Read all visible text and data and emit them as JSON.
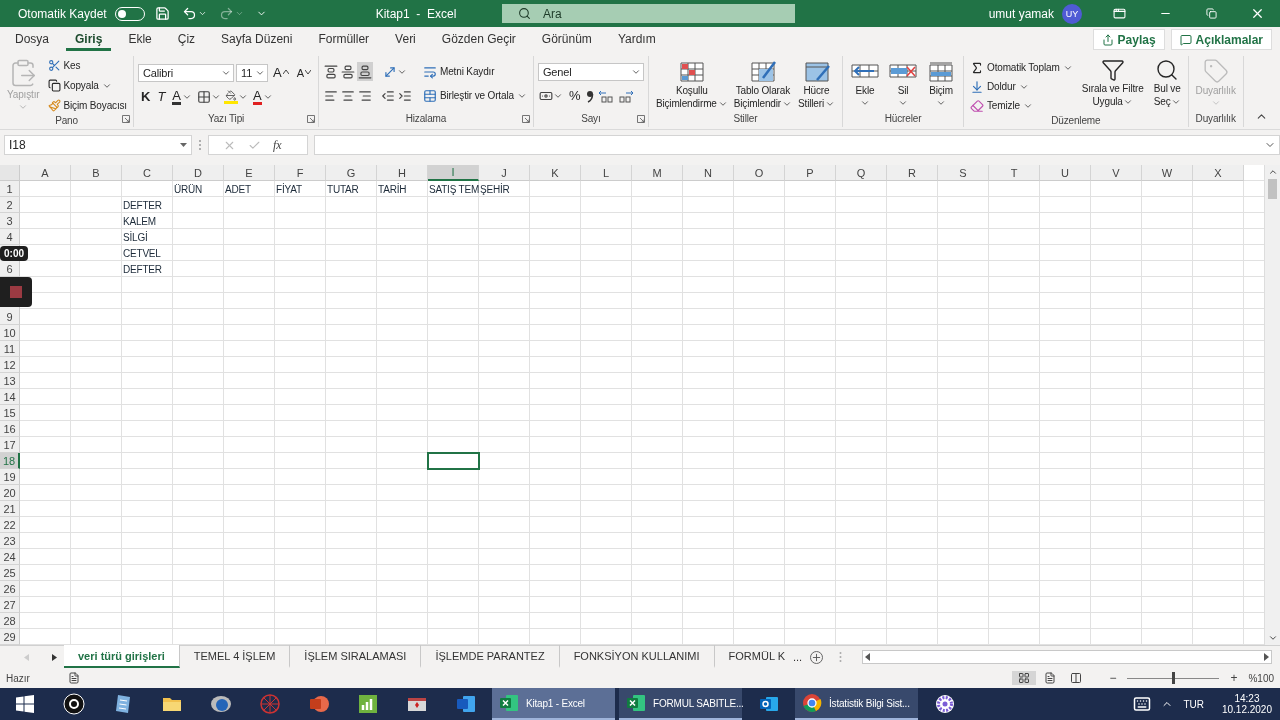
{
  "title_bar": {
    "autosave_label": "Otomatik Kaydet",
    "autosave_on": false,
    "title": "Kitap1  -  Excel",
    "search_placeholder": "Ara",
    "user_name": "umut yamak",
    "user_initials": "UY"
  },
  "menu_tabs": [
    {
      "label": "Dosya",
      "selected": false
    },
    {
      "label": "Giriş",
      "selected": true
    },
    {
      "label": "Ekle",
      "selected": false
    },
    {
      "label": "Çiz",
      "selected": false
    },
    {
      "label": "Sayfa Düzeni",
      "selected": false
    },
    {
      "label": "Formüller",
      "selected": false
    },
    {
      "label": "Veri",
      "selected": false
    },
    {
      "label": "Gözden Geçir",
      "selected": false
    },
    {
      "label": "Görünüm",
      "selected": false
    },
    {
      "label": "Yardım",
      "selected": false
    }
  ],
  "share_button": "Paylaş",
  "comments_button": "Açıklamalar",
  "ribbon": {
    "clipboard": {
      "label": "Pano",
      "paste": "Yapıştır",
      "paste_disabled": true,
      "cut": "Kes",
      "copy": "Kopyala",
      "format_painter": "Biçim Boyacısı"
    },
    "font": {
      "label": "Yazı Tipi",
      "font_name": "Calibri",
      "font_size": "11",
      "grow_font": "A",
      "shrink_font": "A",
      "bold": "K",
      "italic": "T",
      "underline": "A",
      "font_color": "A"
    },
    "alignment": {
      "label": "Hizalama",
      "wrap_text": "Metni Kaydır",
      "merge_center": "Birleştir ve Ortala"
    },
    "number": {
      "label": "Sayı",
      "format": "Genel",
      "percent": "%"
    },
    "styles": {
      "label": "Stiller",
      "buttons": [
        {
          "kind": "conditional",
          "lines": [
            "Koşullu",
            "Biçimlendirme"
          ]
        },
        {
          "kind": "table",
          "lines": [
            "Tablo Olarak",
            "Biçimlendir"
          ]
        },
        {
          "kind": "cellstyle",
          "lines": [
            "Hücre",
            "Stilleri"
          ]
        }
      ]
    },
    "cells": {
      "label": "Hücreler",
      "buttons": [
        {
          "kind": "insert",
          "label": "Ekle"
        },
        {
          "kind": "delete",
          "label": "Sil"
        },
        {
          "kind": "format",
          "label": "Biçim"
        }
      ]
    },
    "editing": {
      "label": "Düzenleme",
      "autosum": "Otomatik Toplam",
      "fill": "Doldur",
      "clear": "Temizle",
      "sort_filter": [
        "Sırala ve Filtre",
        "Uygula"
      ],
      "find_select": [
        "Bul ve",
        "Seç"
      ]
    },
    "sensitivity": {
      "label": "Duyarlılık",
      "button": "Duyarlılık",
      "disabled": true
    }
  },
  "formula_bar": {
    "name_box": "I18",
    "function_label": "fx"
  },
  "columns": [
    {
      "label": "A",
      "selected": false
    },
    {
      "label": "B",
      "selected": false
    },
    {
      "label": "C",
      "selected": false
    },
    {
      "label": "D",
      "selected": false
    },
    {
      "label": "E",
      "selected": false
    },
    {
      "label": "F",
      "selected": false
    },
    {
      "label": "G",
      "selected": false
    },
    {
      "label": "H",
      "selected": false
    },
    {
      "label": "I",
      "selected": true
    },
    {
      "label": "J",
      "selected": false
    },
    {
      "label": "K",
      "selected": false
    },
    {
      "label": "L",
      "selected": false
    },
    {
      "label": "M",
      "selected": false
    },
    {
      "label": "N",
      "selected": false
    },
    {
      "label": "O",
      "selected": false
    },
    {
      "label": "P",
      "selected": false
    },
    {
      "label": "Q",
      "selected": false
    },
    {
      "label": "R",
      "selected": false
    },
    {
      "label": "S",
      "selected": false
    },
    {
      "label": "T",
      "selected": false
    },
    {
      "label": "U",
      "selected": false
    },
    {
      "label": "V",
      "selected": false
    },
    {
      "label": "W",
      "selected": false
    },
    {
      "label": "X",
      "selected": false
    }
  ],
  "rows": [
    {
      "label": "1",
      "selected": false,
      "cells": [
        null,
        null,
        null,
        "ÜRÜN",
        "ADET",
        "FİYAT",
        "TUTAR",
        "TARİH",
        "SATIŞ TEM",
        "ŞEHİR"
      ]
    },
    {
      "label": "2",
      "selected": false,
      "cells": [
        null,
        null,
        "DEFTER"
      ]
    },
    {
      "label": "3",
      "selected": false,
      "cells": [
        null,
        null,
        "KALEM"
      ]
    },
    {
      "label": "4",
      "selected": false,
      "cells": [
        null,
        null,
        "SİLGİ"
      ]
    },
    {
      "cells": [
        null,
        null,
        "CETVEL"
      ]
    },
    {
      "label": "6",
      "selected": false,
      "cells": [
        null,
        null,
        "DEFTER"
      ]
    },
    {},
    {},
    {
      "label": "9",
      "selected": false
    },
    {
      "label": "10",
      "selected": false
    },
    {
      "label": "11",
      "selected": false
    },
    {
      "label": "12",
      "selected": false
    },
    {
      "label": "13",
      "selected": false
    },
    {
      "label": "14",
      "selected": false
    },
    {
      "label": "15",
      "selected": false
    },
    {
      "label": "16",
      "selected": false
    },
    {
      "label": "17",
      "selected": false
    },
    {
      "label": "18",
      "selected": true
    },
    {
      "label": "19",
      "selected": false
    },
    {
      "label": "20",
      "selected": false
    },
    {
      "label": "21",
      "selected": false
    },
    {
      "label": "22",
      "selected": false
    },
    {
      "label": "23",
      "selected": false
    },
    {
      "label": "24",
      "selected": false
    },
    {
      "label": "25",
      "selected": false
    },
    {
      "label": "26",
      "selected": false
    },
    {
      "label": "27",
      "selected": false
    },
    {
      "label": "28",
      "selected": false
    },
    {
      "label": "29",
      "selected": false
    }
  ],
  "recorder": {
    "time": "0:00"
  },
  "sheet_tabs": [
    {
      "label": "veri türü girişleri",
      "selected": true
    },
    {
      "label": "TEMEL 4 İŞLEM",
      "selected": false
    },
    {
      "label": "İŞLEM SIRALAMASI",
      "selected": false
    },
    {
      "label": "İŞLEMDE PARANTEZ",
      "selected": false
    },
    {
      "label": "FONKSİYON KULLANIMI",
      "selected": false
    },
    {
      "label": "FORMÜL K",
      "selected": false
    }
  ],
  "more_sheets": "...",
  "status_bar": {
    "status": "Hazır",
    "zoom_out": "−",
    "zoom_in": "+",
    "zoom": "%100",
    "zoom_level": {
      "level": 0.5
    }
  },
  "taskbar": {
    "items": [
      {
        "kind": "r3"
      },
      {
        "kind": "notepad"
      },
      {
        "kind": "explorer"
      },
      {
        "kind": "r"
      },
      {
        "kind": "web"
      },
      {
        "kind": "powerpoint"
      },
      {
        "kind": "chart"
      },
      {
        "kind": "redbox"
      },
      {
        "kind": "word"
      },
      {
        "kind": "excelwindow",
        "label": "Kitap1 - Excel",
        "selected": true
      },
      {
        "kind": "excelwindow",
        "label": "FORMUL SABITLE...",
        "selected": false
      },
      {
        "kind": "outlook"
      },
      {
        "kind": "chromewindow",
        "label": "İstatistik Bilgi Sist...",
        "selected": false
      },
      {
        "kind": "gear"
      }
    ],
    "language": "TUR",
    "time": "14:23",
    "date": "10.12.2020"
  }
}
